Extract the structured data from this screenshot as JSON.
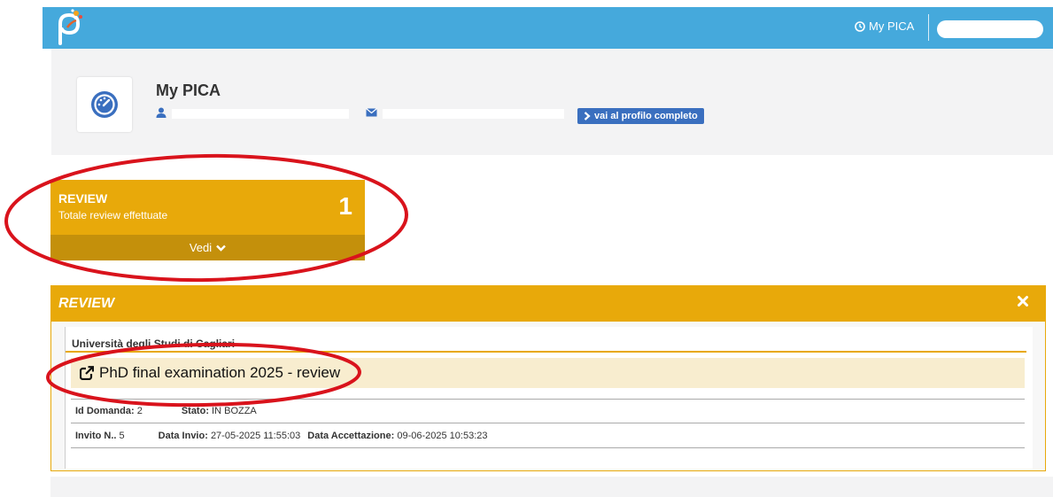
{
  "topbar": {
    "logo_icon": "pica-logo-icon",
    "mypica_label": "My PICA",
    "mypica_icon": "dashboard-clock-icon"
  },
  "profile": {
    "icon": "dashboard-gauge-icon",
    "title": "My PICA",
    "person_icon": "user-icon",
    "mail_icon": "envelope-icon",
    "button_label": "vai al profilo completo",
    "button_icon": "chevron-right-icon",
    "button_color": "#3a6fbf"
  },
  "tile": {
    "title": "REVIEW",
    "subtitle": "Totale review effettuate",
    "count": "1",
    "footer_label": "Vedi",
    "footer_icon": "chevron-down-icon",
    "color": "#e8a90a"
  },
  "review_panel": {
    "title": "REVIEW",
    "close_icon": "close-icon",
    "university": "Università degli Studi di Cagliari",
    "call_title": "PhD final examination 2025 - review",
    "call_icon": "external-link-icon",
    "row1": {
      "id_label": "Id Domanda:",
      "id_value": "2",
      "status_label": "Stato:",
      "status_value": "IN BOZZA"
    },
    "row2": {
      "invite_label": "Invito N..",
      "invite_value": "5",
      "sent_label": "Data Invio:",
      "sent_value": "27-05-2025 11:55:03",
      "accepted_label": "Data Accettazione:",
      "accepted_value": "09-06-2025 10:53:23"
    }
  },
  "annotations": {
    "color": "#d9131c"
  }
}
